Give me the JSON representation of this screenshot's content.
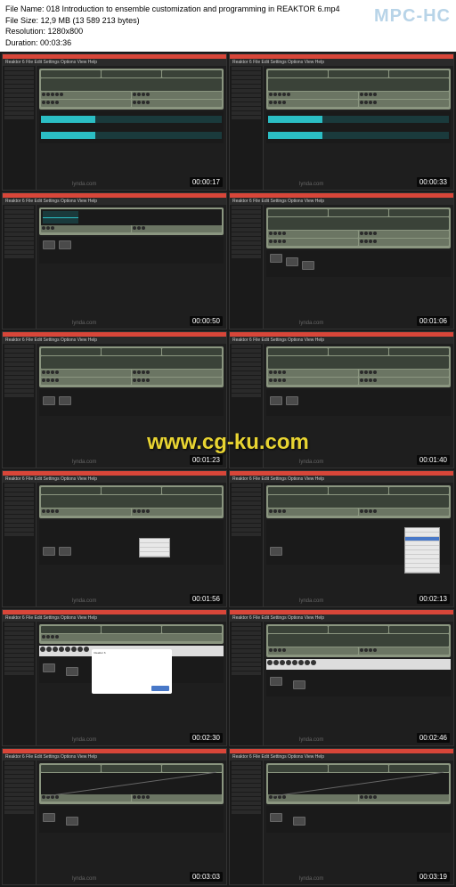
{
  "header": {
    "file_name_label": "File Name:",
    "file_name": "018 Introduction to ensemble customization and programming in REAKTOR 6.mp4",
    "file_size_label": "File Size:",
    "file_size": "12,9 MB (13 589 213 bytes)",
    "resolution_label": "Resolution:",
    "resolution": "1280x800",
    "duration_label": "Duration:",
    "duration": "00:03:36",
    "app_logo": "MPC-HC"
  },
  "app": {
    "title": "REAKTOR",
    "menu": "Reaktor 6   File   Edit   Settings   Options   View   Help"
  },
  "thumbnails": [
    {
      "timestamp": "00:00:17",
      "type": "synth-waveform"
    },
    {
      "timestamp": "00:00:33",
      "type": "synth-waveform"
    },
    {
      "timestamp": "00:00:50",
      "type": "synth-osc"
    },
    {
      "timestamp": "00:01:06",
      "type": "synth-nodes"
    },
    {
      "timestamp": "00:01:23",
      "type": "synth-nodes"
    },
    {
      "timestamp": "00:01:40",
      "type": "synth-nodes"
    },
    {
      "timestamp": "00:01:56",
      "type": "synth-nodes-menu"
    },
    {
      "timestamp": "00:02:13",
      "type": "synth-context"
    },
    {
      "timestamp": "00:02:30",
      "type": "synth-dialog"
    },
    {
      "timestamp": "00:02:46",
      "type": "synth-fx"
    },
    {
      "timestamp": "00:03:03",
      "type": "synth-curve"
    },
    {
      "timestamp": "00:03:19",
      "type": "synth-curve"
    }
  ],
  "watermark": "www.cg-ku.com",
  "lynda": "lynda.com"
}
